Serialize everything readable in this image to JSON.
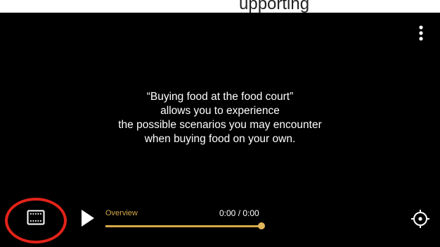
{
  "header": {
    "clipped_text": "upporting"
  },
  "player": {
    "caption_lines": [
      "“Buying food at the food court”",
      "allows you to experience",
      "the possible scenarios you may encounter",
      "when buying food on your own."
    ],
    "controls": {
      "chapter_label": "Overview",
      "time_display": "0:00 / 0:00",
      "progress_fraction": 1.0
    }
  },
  "colors": {
    "background": "#000000",
    "accent": "#d4a84a",
    "highlight": "#e2231a",
    "text": "#ffffff"
  },
  "icons": {
    "menu": "more-vertical-icon",
    "subtitles": "film-strip-icon",
    "play": "play-icon",
    "locate": "crosshair-icon"
  }
}
